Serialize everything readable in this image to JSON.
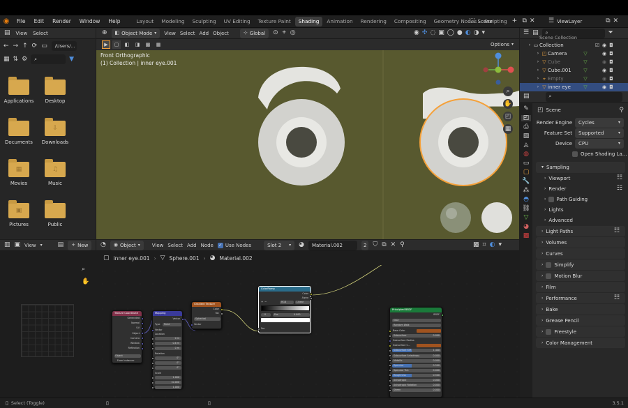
{
  "menu": {
    "file": "File",
    "edit": "Edit",
    "render": "Render",
    "window": "Window",
    "help": "Help"
  },
  "workspaces": [
    "Layout",
    "Modeling",
    "Sculpting",
    "UV Editing",
    "Texture Paint",
    "Shading",
    "Animation",
    "Rendering",
    "Compositing",
    "Geometry Nodes",
    "Scripting"
  ],
  "active_workspace_index": 5,
  "scene_name": "Scene",
  "view_layer": "ViewLayer",
  "file_browser": {
    "view": "View",
    "select": "Select",
    "path": "/Users/...",
    "items": [
      {
        "label": "Applications",
        "symbol": ""
      },
      {
        "label": "Desktop",
        "symbol": ""
      },
      {
        "label": "Documents",
        "symbol": ""
      },
      {
        "label": "Downloads",
        "symbol": "⇩"
      },
      {
        "label": "Movies",
        "symbol": "▦"
      },
      {
        "label": "Music",
        "symbol": "♫"
      },
      {
        "label": "Pictures",
        "symbol": "▣"
      },
      {
        "label": "Public",
        "symbol": ""
      }
    ]
  },
  "viewport": {
    "mode": "Object Mode",
    "view": "View",
    "select": "Select",
    "add": "Add",
    "object": "Object",
    "orientation": "Global",
    "options": "Options",
    "overlay_title": "Front Orthographic",
    "overlay_sub": "(1) Collection | inner eye.001",
    "bg": "#58592f"
  },
  "image_editor": {
    "view": "View",
    "new": "New"
  },
  "node_editor": {
    "type": "Object",
    "view": "View",
    "select": "Select",
    "add": "Add",
    "node": "Node",
    "use_nodes": "Use Nodes",
    "slot": "Slot 2",
    "material": "Material.002",
    "users": "2",
    "breadcrumb": [
      "inner eye.001",
      "Sphere.001",
      "Material.002"
    ],
    "nodes": {
      "texcoord": {
        "title": "Texture Coordinate",
        "outs": [
          "Generated",
          "Normal",
          "UV",
          "Object",
          "Camera",
          "Window",
          "Reflection"
        ],
        "object": "Object",
        "instancer": "From Instancer"
      },
      "mapping": {
        "title": "Mapping",
        "out": "Vector",
        "type_label": "Type",
        "type": "Point",
        "vector": "Vector",
        "location": "Location",
        "loc": [
          "0 m",
          "0.6 m",
          "0 m"
        ],
        "rotation": "Rotation",
        "rot": [
          "0°",
          "0°",
          "0°"
        ],
        "scale": "Scale",
        "scl": [
          "1.000",
          "10.000",
          "1.000"
        ]
      },
      "gradient": {
        "title": "Gradient Texture",
        "outs": [
          "Color",
          "Fac"
        ],
        "type": "Spherical",
        "vector": "Vector"
      },
      "colorramp": {
        "title": "ColorRamp",
        "outs": [
          "Color",
          "Alpha"
        ],
        "mode": "RGB",
        "interp": "Linear",
        "index": "0",
        "pos_label": "Pos",
        "pos": "0.000",
        "fac": "Fac"
      },
      "bsdf": {
        "title": "Principled BSDF",
        "out": "BSDF",
        "dist": "GGX",
        "sss": "Random Walk",
        "rows": [
          [
            "Base Color",
            ""
          ],
          [
            "Subsurface",
            "0.000"
          ],
          [
            "Subsurface Radius",
            ""
          ],
          [
            "Subsurface C...",
            ""
          ],
          [
            "Subsurface IOR",
            "1.400"
          ],
          [
            "Subsurface Anisotropy",
            "0.000"
          ],
          [
            "Metallic",
            "0.000"
          ],
          [
            "Specular",
            "0.500"
          ],
          [
            "Specular Tint",
            "0.000"
          ],
          [
            "Roughness",
            "0.500"
          ],
          [
            "Anisotropic",
            "0.000"
          ],
          [
            "Anisotropic Rotation",
            "0.000"
          ],
          [
            "Sheen",
            "0.000"
          ]
        ]
      }
    }
  },
  "outliner": {
    "scene_collection": "Scene Collection",
    "items": [
      {
        "name": "Collection",
        "indent": 0,
        "dim": false
      },
      {
        "name": "Camera",
        "indent": 1,
        "dim": false
      },
      {
        "name": "Cube",
        "indent": 1,
        "dim": true
      },
      {
        "name": "Cube.001",
        "indent": 1,
        "dim": false
      },
      {
        "name": "Empty",
        "indent": 1,
        "dim": true
      },
      {
        "name": "inner eye",
        "indent": 1,
        "dim": false
      }
    ]
  },
  "properties": {
    "scene": "Scene",
    "render_engine_label": "Render Engine",
    "render_engine": "Cycles",
    "feature_set_label": "Feature Set",
    "feature_set": "Supported",
    "device_label": "Device",
    "device": "CPU",
    "osl": "Open Shading La...",
    "sampling": "Sampling",
    "viewport": "Viewport",
    "render": "Render",
    "path_guiding": "Path Guiding",
    "lights": "Lights",
    "advanced": "Advanced",
    "sections": [
      "Light Paths",
      "Volumes",
      "Curves",
      "Simplify",
      "Motion Blur",
      "Film",
      "Performance",
      "Bake",
      "Grease Pencil",
      "Freestyle",
      "Color Management"
    ]
  },
  "status": {
    "left": "Select (Toggle)",
    "version": "3.5.1"
  },
  "colors": {
    "accent": "#4772b3",
    "selected_orange": "#f5a13a",
    "header_green": "#1a7a3a"
  }
}
